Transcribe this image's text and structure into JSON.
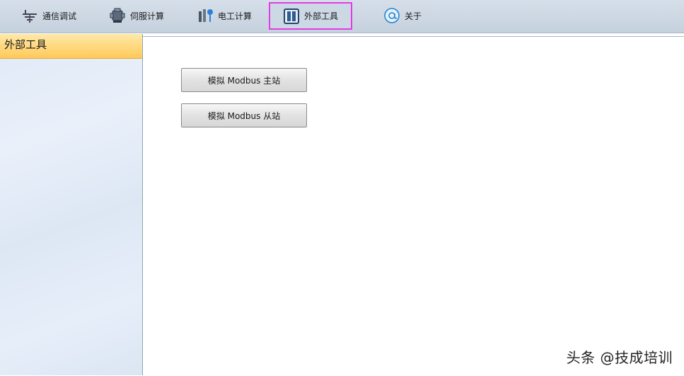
{
  "toolbar": {
    "items": [
      {
        "label": "通信调试",
        "icon": "antenna-icon"
      },
      {
        "label": "伺服计算",
        "icon": "servo-motor-icon"
      },
      {
        "label": "电工计算",
        "icon": "electrician-tools-icon"
      },
      {
        "label": "外部工具",
        "icon": "columns-icon",
        "active": true
      },
      {
        "label": "关于",
        "icon": "at-sign-icon"
      }
    ],
    "active_border_color": "#e43be8"
  },
  "sidebar": {
    "title": "外部工具"
  },
  "main": {
    "buttons": [
      {
        "label": "模拟 Modbus 主站"
      },
      {
        "label": "模拟 Modbus 从站"
      }
    ]
  },
  "watermark": "头条 @技成培训"
}
